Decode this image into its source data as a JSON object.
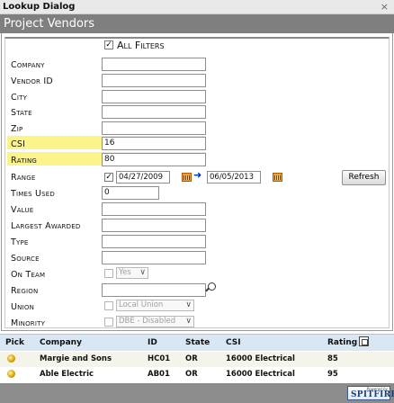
{
  "window": {
    "title": "Lookup Dialog",
    "close_glyph": "×"
  },
  "header": {
    "title": "Project Vendors"
  },
  "filters": {
    "all_filters": {
      "label": "All Filters",
      "checked": true
    },
    "fields": [
      {
        "label": "Company",
        "value": ""
      },
      {
        "label": "Vendor ID",
        "value": ""
      },
      {
        "label": "City",
        "value": ""
      },
      {
        "label": "State",
        "value": ""
      },
      {
        "label": "Zip",
        "value": ""
      },
      {
        "label": "CSI",
        "value": "16",
        "highlighted": true
      },
      {
        "label": "Rating",
        "value": "80",
        "highlighted": true
      },
      {
        "label": "Range",
        "value": ""
      },
      {
        "label": "Times Used",
        "value": "0"
      },
      {
        "label": "Value",
        "value": ""
      },
      {
        "label": "Largest Awarded",
        "value": ""
      },
      {
        "label": "Type",
        "value": ""
      },
      {
        "label": "Source",
        "value": ""
      },
      {
        "label": "On Team",
        "value": ""
      },
      {
        "label": "Region",
        "value": ""
      },
      {
        "label": "Union",
        "value": ""
      },
      {
        "label": "Minority",
        "value": ""
      }
    ],
    "range": {
      "checked": true,
      "from": "04/27/2009",
      "to": "06/05/2013"
    },
    "on_team": {
      "checked": false,
      "selected": "Yes"
    },
    "union": {
      "checked": false,
      "selected": "Local Union"
    },
    "minority": {
      "checked": false,
      "selected": "DBE - Disabled"
    },
    "refresh_label": "Refresh"
  },
  "results": {
    "columns": [
      "Pick",
      "Company",
      "ID",
      "State",
      "CSI",
      "Rating"
    ],
    "rows": [
      {
        "company": "Margie and Sons",
        "id": "HC01",
        "state": "OR",
        "csi": "16000 Electrical",
        "rating": "85"
      },
      {
        "company": "Able Electric",
        "id": "AB01",
        "state": "OR",
        "csi": "16000 Electrical",
        "rating": "95"
      }
    ]
  },
  "footer": {
    "logo_tagline": "Powered by",
    "logo_text": "SPITFIRE"
  },
  "colors": {
    "highlight": "#fbf48a",
    "header_bg": "#7f7f7f",
    "table_header_bg": "#d9e6f3",
    "row_alt_bg": "#f4f4ea"
  },
  "icons": [
    "close-icon",
    "checkbox-icon",
    "calendar-icon",
    "arrow-right-icon",
    "chevron-down-icon",
    "magnifier-icon",
    "pick-coin-icon",
    "sort-icon",
    "spitfire-logo"
  ]
}
